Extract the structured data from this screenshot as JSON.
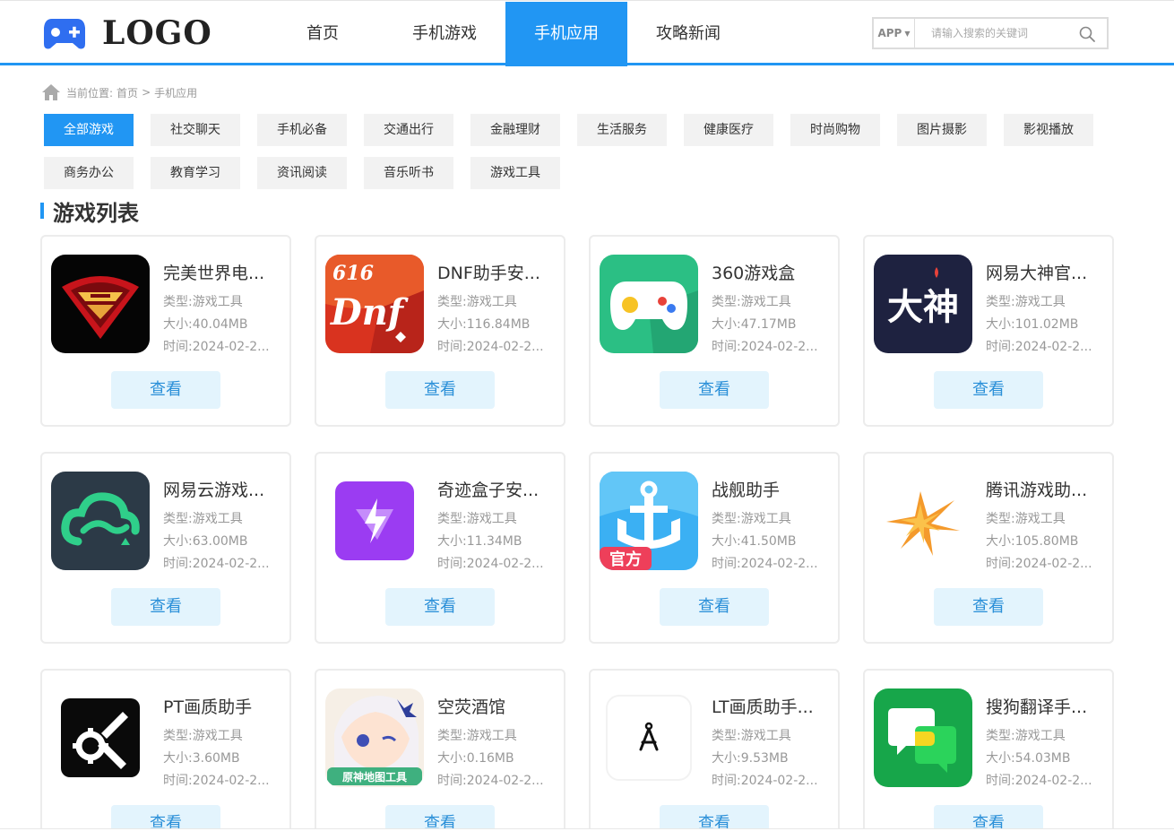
{
  "header": {
    "logo_text": "LOGO",
    "nav": [
      {
        "label": "首页",
        "active": false
      },
      {
        "label": "手机游戏",
        "active": false
      },
      {
        "label": "手机应用",
        "active": true
      },
      {
        "label": "攻略新闻",
        "active": false
      }
    ],
    "search": {
      "select_label": "APP",
      "placeholder": "请输入搜索的关键词"
    }
  },
  "breadcrumb": {
    "prefix": "当前位置:",
    "home": "首页",
    "separator": ">",
    "current": "手机应用"
  },
  "categories": [
    {
      "label": "全部游戏",
      "active": true
    },
    {
      "label": "社交聊天"
    },
    {
      "label": "手机必备"
    },
    {
      "label": "交通出行"
    },
    {
      "label": "金融理财"
    },
    {
      "label": "生活服务"
    },
    {
      "label": "健康医疗"
    },
    {
      "label": "时尚购物"
    },
    {
      "label": "图片摄影"
    },
    {
      "label": "影视播放"
    },
    {
      "label": "商务办公"
    },
    {
      "label": "教育学习"
    },
    {
      "label": "资讯阅读"
    },
    {
      "label": "音乐听书"
    },
    {
      "label": "游戏工具"
    }
  ],
  "section_title": "游戏列表",
  "labels": {
    "type": "类型:",
    "size": "大小:",
    "time": "时间:",
    "view": "查看"
  },
  "apps": [
    {
      "name": "完美世界电...",
      "type": "游戏工具",
      "size": "40.04MB",
      "time": "2024-02-2...",
      "icon": "perfect-world-icon"
    },
    {
      "name": "DNF助手安...",
      "type": "游戏工具",
      "size": "116.84MB",
      "time": "2024-02-2...",
      "icon": "dnf-icon"
    },
    {
      "name": "360游戏盒",
      "type": "游戏工具",
      "size": "47.17MB",
      "time": "2024-02-2...",
      "icon": "gamepad-icon"
    },
    {
      "name": "网易大神官...",
      "type": "游戏工具",
      "size": "101.02MB",
      "time": "2024-02-2...",
      "icon": "dashen-icon",
      "icon_text": "大神"
    },
    {
      "name": "网易云游戏...",
      "type": "游戏工具",
      "size": "63.00MB",
      "time": "2024-02-2...",
      "icon": "cloud-game-icon"
    },
    {
      "name": "奇迹盒子安...",
      "type": "游戏工具",
      "size": "11.34MB",
      "time": "2024-02-2...",
      "icon": "lightning-icon"
    },
    {
      "name": "战舰助手",
      "type": "游戏工具",
      "size": "41.50MB",
      "time": "2024-02-2...",
      "icon": "warship-icon",
      "icon_text": "官方"
    },
    {
      "name": "腾讯游戏助...",
      "type": "游戏工具",
      "size": "105.80MB",
      "time": "2024-02-2...",
      "icon": "star-burst-icon"
    },
    {
      "name": "PT画质助手",
      "type": "游戏工具",
      "size": "3.60MB",
      "time": "2024-02-2...",
      "icon": "wrench-gear-icon"
    },
    {
      "name": "空荧酒馆",
      "type": "游戏工具",
      "size": "0.16MB",
      "time": "2024-02-2...",
      "icon": "anime-girl-icon",
      "icon_text": "原神地图工具"
    },
    {
      "name": "LT画质助手...",
      "type": "游戏工具",
      "size": "9.53MB",
      "time": "2024-02-2...",
      "icon": "compass-icon"
    },
    {
      "name": "搜狗翻译手...",
      "type": "游戏工具",
      "size": "54.03MB",
      "time": "2024-02-2...",
      "icon": "translate-bubble-icon"
    }
  ],
  "colors": {
    "accent": "#2196f3",
    "chip_bg": "#f2f2f2",
    "view_btn_bg": "#e3f4fd",
    "view_btn_text": "#2a8fd8"
  }
}
